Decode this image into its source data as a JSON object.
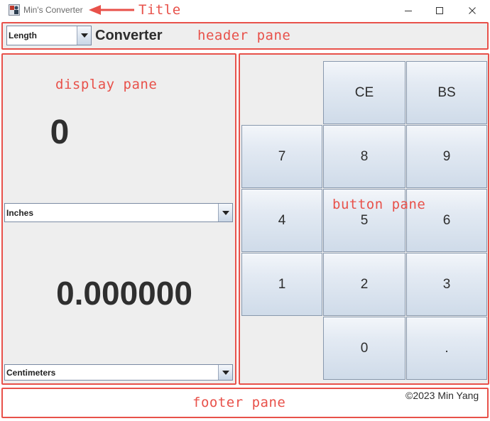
{
  "window": {
    "title": "Min's Converter"
  },
  "header": {
    "category_select": "Length",
    "title": "Converter"
  },
  "display": {
    "input_value": "0",
    "from_unit": "Inches",
    "output_value": "0.000000",
    "to_unit": "Centimeters"
  },
  "keypad": {
    "ce": "CE",
    "bs": "BS",
    "k7": "7",
    "k8": "8",
    "k9": "9",
    "k4": "4",
    "k5": "5",
    "k6": "6",
    "k1": "1",
    "k2": "2",
    "k3": "3",
    "k0": "0",
    "dot": "."
  },
  "footer": {
    "copyright": "©2023 Min Yang"
  },
  "annotations": {
    "title": "Title",
    "header_pane": "header pane",
    "display_pane": "display pane",
    "button_pane": "button pane",
    "footer_pane": "footer pane"
  },
  "colors": {
    "annotation": "#e8514a",
    "pane_background": "#eeeeee",
    "button_gradient_top": "#f3f6fa",
    "button_gradient_bottom": "#cfdbe9"
  }
}
